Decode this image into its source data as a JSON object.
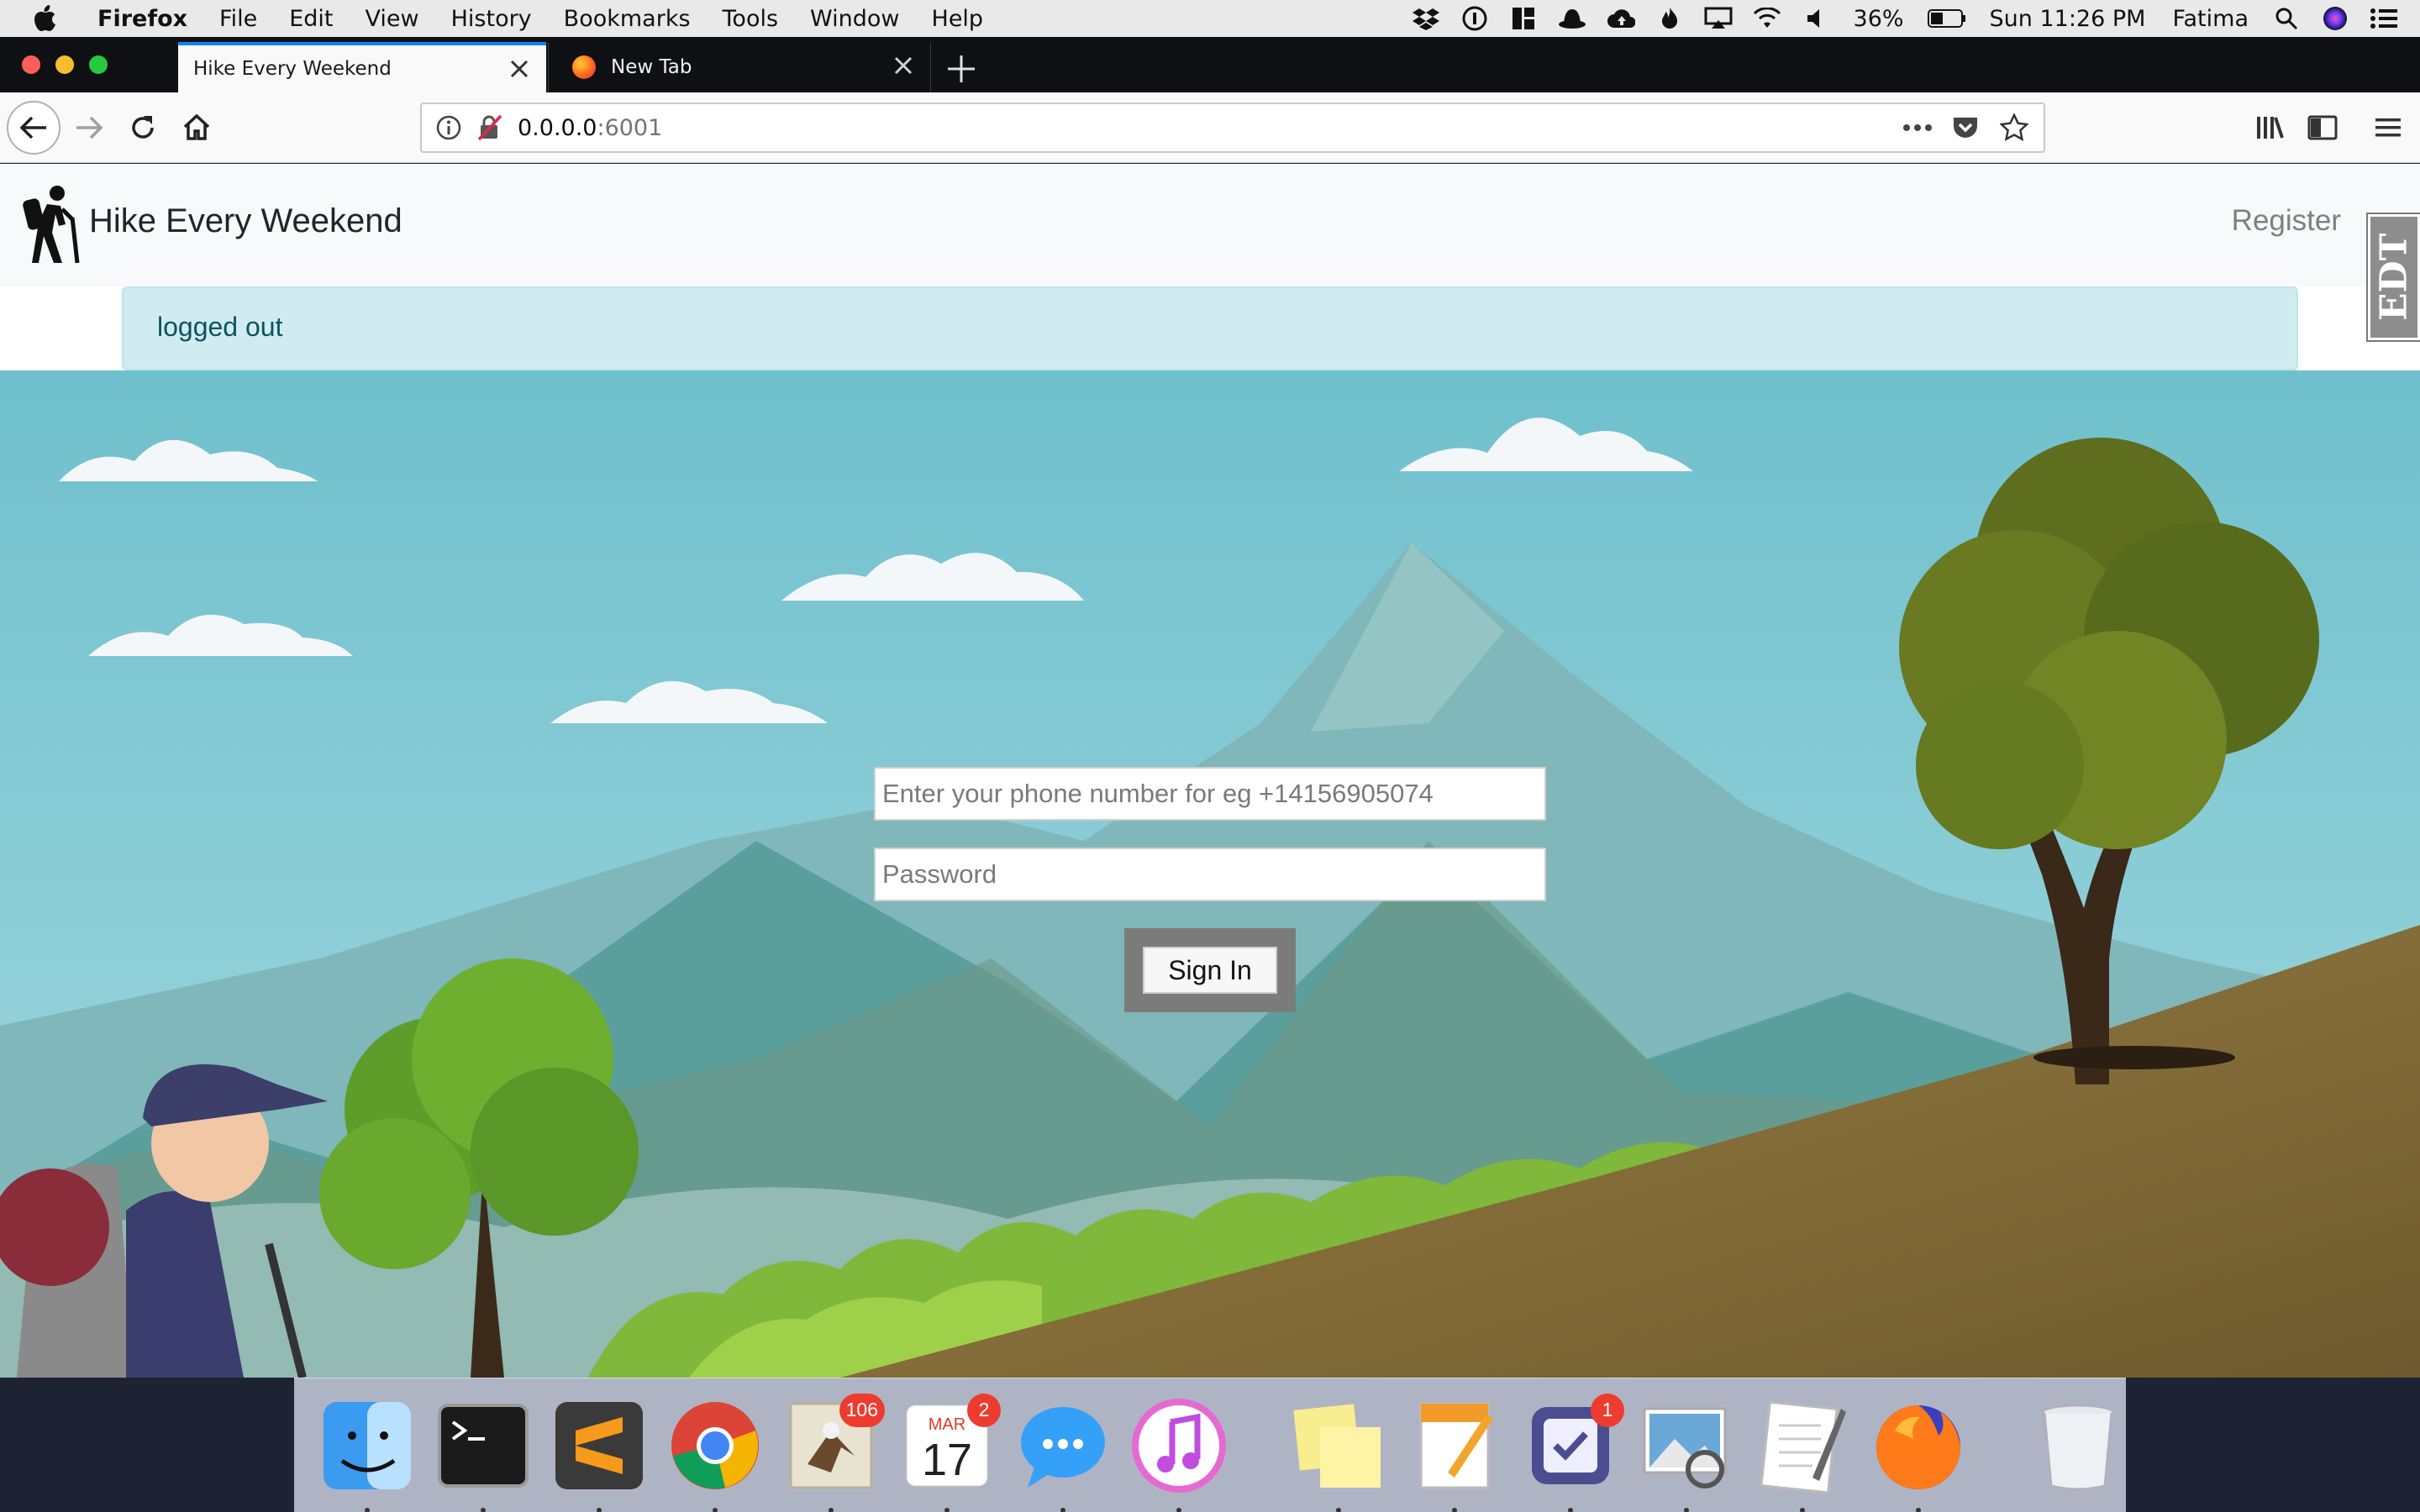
{
  "menubar": {
    "app_name": "Firefox",
    "menus": [
      "File",
      "Edit",
      "View",
      "History",
      "Bookmarks",
      "Tools",
      "Window",
      "Help"
    ],
    "battery_percent": "36%",
    "clock": "Sun 11:26 PM",
    "user_name": "Fatima",
    "status_icons": [
      "dropbox-icon",
      "1password-icon",
      "tiles-icon",
      "hat-icon",
      "cloud-upload-icon",
      "flame-icon",
      "airplay-icon",
      "wifi-icon",
      "volume-icon",
      "battery-icon",
      "spotlight-search-icon",
      "siri-icon",
      "notification-center-icon"
    ]
  },
  "browser": {
    "tabs": [
      {
        "title": "Hike Every Weekend",
        "active": true
      },
      {
        "title": "New Tab",
        "active": false
      }
    ],
    "url_host": "0.0.0.0",
    "url_port": ":6001"
  },
  "site": {
    "brand_name": "Hike Every Weekend",
    "register_label": "Register",
    "extension_badge": "EDT",
    "alert_message": "logged out",
    "phone_placeholder": "Enter your phone number for eg +14156905074",
    "password_placeholder": "Password",
    "signin_label": "Sign In"
  },
  "dock": {
    "apps": [
      {
        "name": "finder-icon",
        "badge": ""
      },
      {
        "name": "terminal-icon",
        "badge": ""
      },
      {
        "name": "sublime-text-icon",
        "badge": ""
      },
      {
        "name": "chrome-icon",
        "badge": ""
      },
      {
        "name": "mail-icon",
        "badge": "106"
      },
      {
        "name": "calendar-icon",
        "badge": "2",
        "month": "MAR",
        "day": "17"
      },
      {
        "name": "messages-icon",
        "badge": ""
      },
      {
        "name": "itunes-icon",
        "badge": ""
      },
      {
        "name": "stickies-icon",
        "badge": ""
      },
      {
        "name": "pages-icon",
        "badge": ""
      },
      {
        "name": "omnifocus-icon",
        "badge": "1"
      },
      {
        "name": "preview-icon",
        "badge": ""
      },
      {
        "name": "textedit-icon",
        "badge": ""
      },
      {
        "name": "firefox-icon",
        "badge": ""
      },
      {
        "name": "trash-icon",
        "badge": ""
      }
    ]
  },
  "colors": {
    "sky": "#77c3cf",
    "alert_bg": "#d1ecf1",
    "alert_text": "#0c5460",
    "tab_accent": "#0a84ff"
  }
}
